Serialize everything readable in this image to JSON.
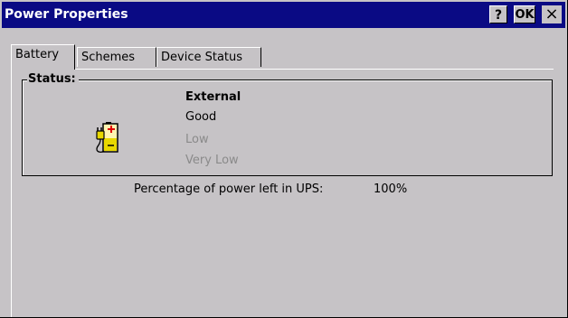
{
  "window": {
    "title": "Power Properties",
    "help_label": "?",
    "ok_label": "OK",
    "close_label": "×"
  },
  "tabs": [
    {
      "label": "Battery",
      "active": true
    },
    {
      "label": "Schemes",
      "active": false
    },
    {
      "label": "Device Status",
      "active": false
    }
  ],
  "status": {
    "group_label": "Status:",
    "icon": "battery-plug-icon",
    "levels": [
      "External",
      "Good",
      "Low",
      "Very Low"
    ],
    "active_level": "External"
  },
  "ups": {
    "label": "Percentage of power left in UPS:",
    "value": "100%"
  }
}
